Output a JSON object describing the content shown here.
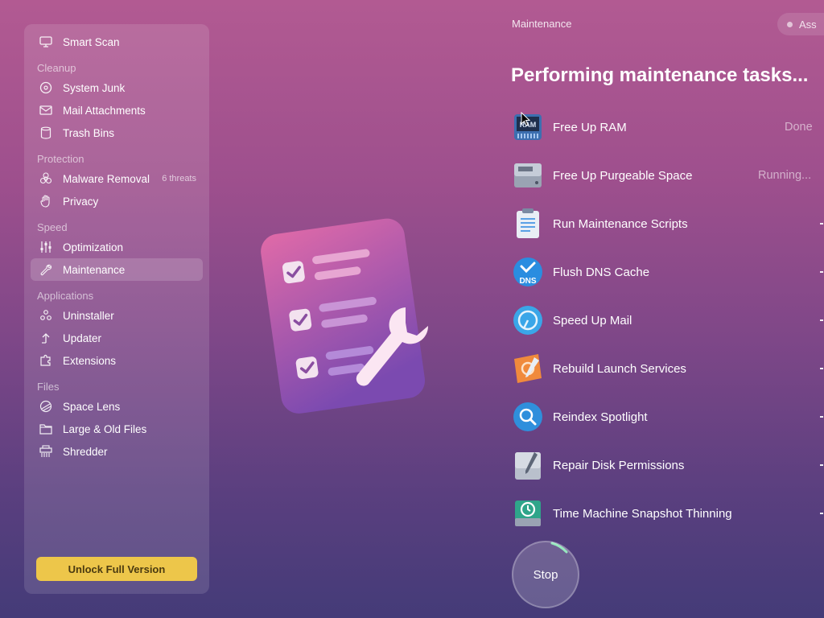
{
  "sidebar": {
    "smart_scan": "Smart Scan",
    "sections": {
      "cleanup": "Cleanup",
      "protection": "Protection",
      "speed": "Speed",
      "applications": "Applications",
      "files": "Files"
    },
    "items": {
      "system_junk": "System Junk",
      "mail_attachments": "Mail Attachments",
      "trash_bins": "Trash Bins",
      "malware_removal": "Malware Removal",
      "malware_badge": "6 threats",
      "privacy": "Privacy",
      "optimization": "Optimization",
      "maintenance": "Maintenance",
      "uninstaller": "Uninstaller",
      "updater": "Updater",
      "extensions": "Extensions",
      "space_lens": "Space Lens",
      "large_old_files": "Large & Old Files",
      "shredder": "Shredder"
    },
    "unlock_label": "Unlock Full Version"
  },
  "header": {
    "breadcrumb": "Maintenance",
    "assistant_label": "Ass"
  },
  "main": {
    "title": "Performing maintenance tasks...",
    "tasks": [
      {
        "label": "Free Up RAM",
        "status": "Done",
        "icon": "ram-icon"
      },
      {
        "label": "Free Up Purgeable Space",
        "status": "Running...",
        "icon": "drive-icon"
      },
      {
        "label": "Run Maintenance Scripts",
        "status": "",
        "icon": "clipboard-icon"
      },
      {
        "label": "Flush DNS Cache",
        "status": "",
        "icon": "dns-icon"
      },
      {
        "label": "Speed Up Mail",
        "status": "",
        "icon": "mail-stamp-icon"
      },
      {
        "label": "Rebuild Launch Services",
        "status": "",
        "icon": "launch-services-icon"
      },
      {
        "label": "Reindex Spotlight",
        "status": "",
        "icon": "spotlight-icon"
      },
      {
        "label": "Repair Disk Permissions",
        "status": "",
        "icon": "disk-utility-icon"
      },
      {
        "label": "Time Machine Snapshot Thinning",
        "status": "",
        "icon": "time-machine-icon"
      }
    ],
    "ram_icon_text": "RAM",
    "dns_icon_text": "DNS",
    "stop_label": "Stop"
  },
  "colors": {
    "accent_yellow": "#edc64a",
    "bg_top": "#b25a92",
    "bg_bottom": "#443b78",
    "progress": "#7fe3b0"
  }
}
